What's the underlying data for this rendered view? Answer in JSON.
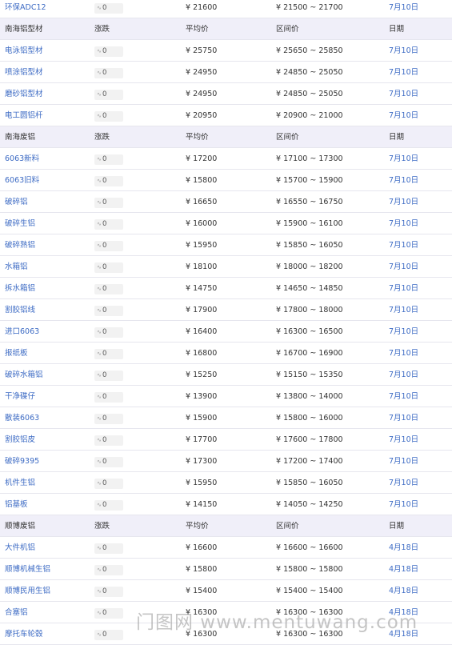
{
  "currency": "¥",
  "range_sep": " ~ ",
  "rows": [
    {
      "kind": "item",
      "name": "环保ADC12",
      "change": "0",
      "avg": "21600",
      "low": "21500",
      "high": "21700",
      "date": "7月10日"
    },
    {
      "kind": "header",
      "name": "南海铝型材",
      "change": "涨跌",
      "avg": "平均价",
      "range": "区间价",
      "date": "日期"
    },
    {
      "kind": "item",
      "name": "电泳铝型材",
      "change": "0",
      "avg": "25750",
      "low": "25650",
      "high": "25850",
      "date": "7月10日"
    },
    {
      "kind": "item",
      "name": "喷涂铝型材",
      "change": "0",
      "avg": "24950",
      "low": "24850",
      "high": "25050",
      "date": "7月10日"
    },
    {
      "kind": "item",
      "name": "磨砂铝型材",
      "change": "0",
      "avg": "24950",
      "low": "24850",
      "high": "25050",
      "date": "7月10日"
    },
    {
      "kind": "item",
      "name": "电工圆铝杆",
      "change": "0",
      "avg": "20950",
      "low": "20900",
      "high": "21000",
      "date": "7月10日"
    },
    {
      "kind": "header",
      "name": "南海废铝",
      "change": "涨跌",
      "avg": "平均价",
      "range": "区间价",
      "date": "日期"
    },
    {
      "kind": "item",
      "name": "6063新料",
      "change": "0",
      "avg": "17200",
      "low": "17100",
      "high": "17300",
      "date": "7月10日"
    },
    {
      "kind": "item",
      "name": "6063旧料",
      "change": "0",
      "avg": "15800",
      "low": "15700",
      "high": "15900",
      "date": "7月10日"
    },
    {
      "kind": "item",
      "name": "破碎铝",
      "change": "0",
      "avg": "16650",
      "low": "16550",
      "high": "16750",
      "date": "7月10日"
    },
    {
      "kind": "item",
      "name": "破碎生铝",
      "change": "0",
      "avg": "16000",
      "low": "15900",
      "high": "16100",
      "date": "7月10日"
    },
    {
      "kind": "item",
      "name": "破碎熟铝",
      "change": "0",
      "avg": "15950",
      "low": "15850",
      "high": "16050",
      "date": "7月10日"
    },
    {
      "kind": "item",
      "name": "水箱铝",
      "change": "0",
      "avg": "18100",
      "low": "18000",
      "high": "18200",
      "date": "7月10日"
    },
    {
      "kind": "item",
      "name": "拆水箱铝",
      "change": "0",
      "avg": "14750",
      "low": "14650",
      "high": "14850",
      "date": "7月10日"
    },
    {
      "kind": "item",
      "name": "割胶铝线",
      "change": "0",
      "avg": "17900",
      "low": "17800",
      "high": "18000",
      "date": "7月10日"
    },
    {
      "kind": "item",
      "name": "进口6063",
      "change": "0",
      "avg": "16400",
      "low": "16300",
      "high": "16500",
      "date": "7月10日"
    },
    {
      "kind": "item",
      "name": "报纸板",
      "change": "0",
      "avg": "16800",
      "low": "16700",
      "high": "16900",
      "date": "7月10日"
    },
    {
      "kind": "item",
      "name": "破碎水箱铝",
      "change": "0",
      "avg": "15250",
      "low": "15150",
      "high": "15350",
      "date": "7月10日"
    },
    {
      "kind": "item",
      "name": "干净碟仔",
      "change": "0",
      "avg": "13900",
      "low": "13800",
      "high": "14000",
      "date": "7月10日"
    },
    {
      "kind": "item",
      "name": "散装6063",
      "change": "0",
      "avg": "15900",
      "low": "15800",
      "high": "16000",
      "date": "7月10日"
    },
    {
      "kind": "item",
      "name": "割胶铝皮",
      "change": "0",
      "avg": "17700",
      "low": "17600",
      "high": "17800",
      "date": "7月10日"
    },
    {
      "kind": "item",
      "name": "破碎9395",
      "change": "0",
      "avg": "17300",
      "low": "17200",
      "high": "17400",
      "date": "7月10日"
    },
    {
      "kind": "item",
      "name": "机件生铝",
      "change": "0",
      "avg": "15950",
      "low": "15850",
      "high": "16050",
      "date": "7月10日"
    },
    {
      "kind": "item",
      "name": "铝基板",
      "change": "0",
      "avg": "14150",
      "low": "14050",
      "high": "14250",
      "date": "7月10日"
    },
    {
      "kind": "header",
      "name": "顺博废铝",
      "change": "涨跌",
      "avg": "平均价",
      "range": "区间价",
      "date": "日期"
    },
    {
      "kind": "item",
      "name": "大件机铝",
      "change": "0",
      "avg": "16600",
      "low": "16600",
      "high": "16600",
      "date": "4月18日"
    },
    {
      "kind": "item",
      "name": "顺博机械生铝",
      "change": "0",
      "avg": "15800",
      "low": "15800",
      "high": "15800",
      "date": "4月18日"
    },
    {
      "kind": "item",
      "name": "顺博民用生铝",
      "change": "0",
      "avg": "15400",
      "low": "15400",
      "high": "15400",
      "date": "4月18日"
    },
    {
      "kind": "item",
      "name": "合塞铝",
      "change": "0",
      "avg": "16300",
      "low": "16300",
      "high": "16300",
      "date": "4月18日"
    },
    {
      "kind": "item",
      "name": "摩托车轮毂",
      "change": "0",
      "avg": "16300",
      "low": "16300",
      "high": "16300",
      "date": "4月18日"
    }
  ],
  "watermark": "门图网 www.mentuwang.com",
  "icons": {
    "change": "wave-icon"
  },
  "colors": {
    "link": "#3d6bc4",
    "header_bg": "#f0eff9",
    "badge_bg": "#f2f2f2"
  }
}
